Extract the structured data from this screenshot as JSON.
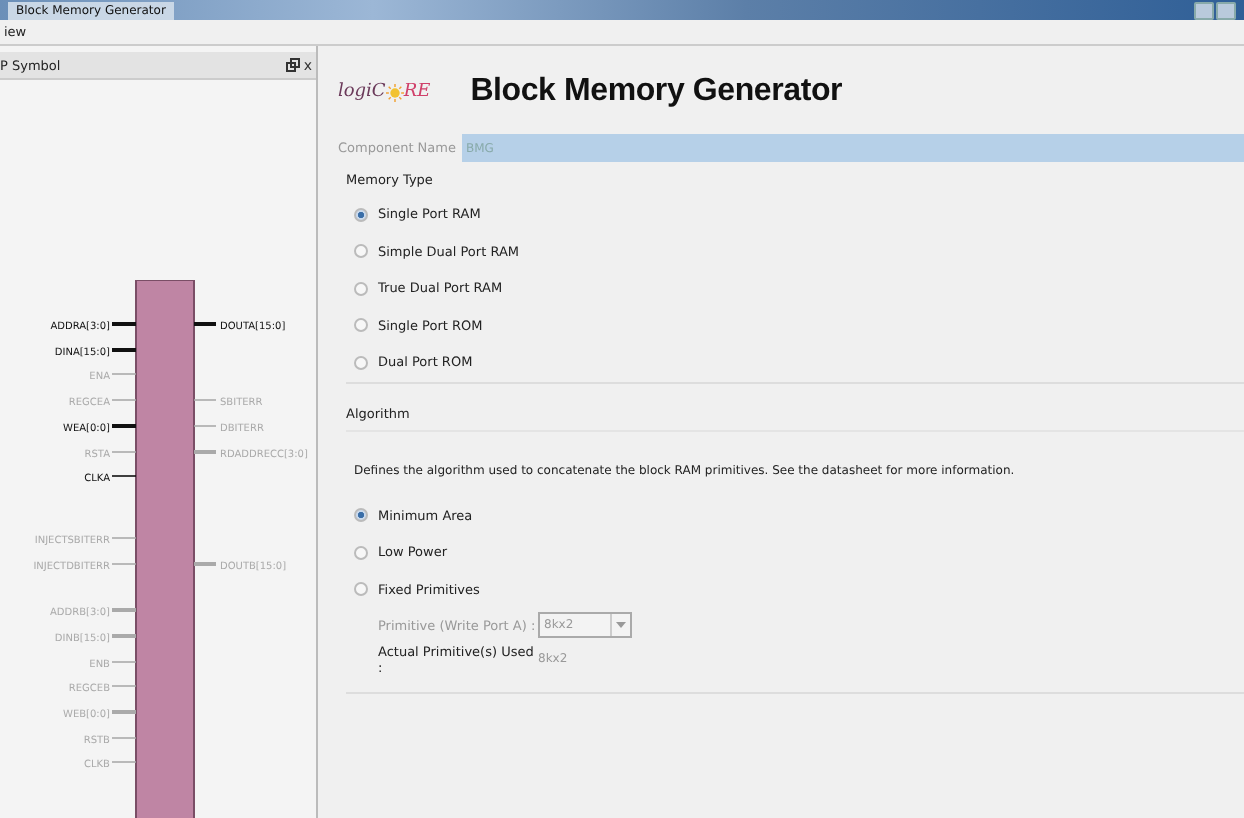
{
  "window": {
    "title": "Block Memory Generator"
  },
  "menu": [
    "iew"
  ],
  "symbol_panel": {
    "title": "P Symbol",
    "close": "x",
    "left_pins": [
      {
        "label": "ADDRA[3:0]",
        "active": true,
        "bus": true
      },
      {
        "label": "DINA[15:0]",
        "active": true,
        "bus": true
      },
      {
        "label": "ENA",
        "active": false,
        "bus": false
      },
      {
        "label": "REGCEA",
        "active": false,
        "bus": false
      },
      {
        "label": "WEA[0:0]",
        "active": true,
        "bus": true
      },
      {
        "label": "RSTA",
        "active": false,
        "bus": false
      },
      {
        "label": "CLKA",
        "active": true,
        "bus": false
      },
      {
        "label": "INJECTSBITERR",
        "active": false,
        "bus": false
      },
      {
        "label": "INJECTDBITERR",
        "active": false,
        "bus": false
      },
      {
        "label": "ADDRB[3:0]",
        "active": false,
        "bus": true
      },
      {
        "label": "DINB[15:0]",
        "active": false,
        "bus": true
      },
      {
        "label": "ENB",
        "active": false,
        "bus": false
      },
      {
        "label": "REGCEB",
        "active": false,
        "bus": false
      },
      {
        "label": "WEB[0:0]",
        "active": false,
        "bus": true
      },
      {
        "label": "RSTB",
        "active": false,
        "bus": false
      },
      {
        "label": "CLKB",
        "active": false,
        "bus": false
      }
    ],
    "right_pins": [
      {
        "label": "DOUTA[15:0]",
        "active": true,
        "bus": true
      },
      {
        "label": "SBITERR",
        "active": false,
        "bus": false
      },
      {
        "label": "DBITERR",
        "active": false,
        "bus": false
      },
      {
        "label": "RDADDRECC[3:0]",
        "active": false,
        "bus": true
      },
      {
        "label": "DOUTB[15:0]",
        "active": false,
        "bus": true
      }
    ]
  },
  "header": {
    "logo_before": "logiC",
    "logo_after": "RE",
    "title": "Block Memory Generator"
  },
  "component_name": {
    "label": "Component Name",
    "value": "BMG"
  },
  "memory_type": {
    "title": "Memory Type",
    "options": [
      {
        "label": "Single Port RAM",
        "selected": true
      },
      {
        "label": "Simple Dual Port RAM",
        "selected": false
      },
      {
        "label": "True Dual Port RAM",
        "selected": false
      },
      {
        "label": "Single Port ROM",
        "selected": false
      },
      {
        "label": "Dual Port ROM",
        "selected": false
      }
    ]
  },
  "algorithm": {
    "title": "Algorithm",
    "description": "Defines the algorithm used to concatenate the block RAM primitives.  See the datasheet for more information.",
    "options": [
      {
        "label": "Minimum Area",
        "selected": true
      },
      {
        "label": "Low Power",
        "selected": false
      },
      {
        "label": "Fixed Primitives",
        "selected": false
      }
    ],
    "primitive": {
      "label": "Primitive (Write Port A) :",
      "value": "8kx2",
      "disabled": true
    },
    "actual": {
      "label": "Actual Primitive(s) Used :",
      "value": "8kx2"
    }
  }
}
